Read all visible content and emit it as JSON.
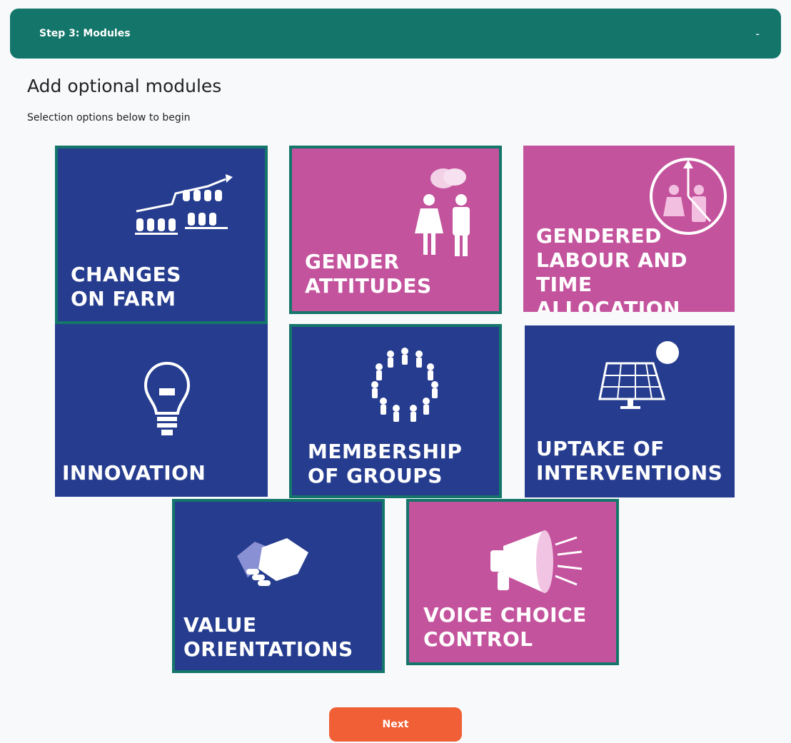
{
  "header": {
    "title": "Step 3: Modules",
    "toggle": "-"
  },
  "page": {
    "title": "Add optional modules",
    "subtitle": "Selection options below to begin"
  },
  "modules": [
    {
      "label": "CHANGES\nON FARM",
      "icon": "farm-growth-icon",
      "color": "#263d8f",
      "selected": true
    },
    {
      "label": "GENDER\nATTITUDES",
      "icon": "gender-people-icon",
      "color": "#c4539d",
      "selected": true
    },
    {
      "label": "GENDERED\nLABOUR AND\nTIME ALLOCATION",
      "icon": "clock-people-icon",
      "color": "#c4539d",
      "selected": false
    },
    {
      "label": "INNOVATION",
      "icon": "light-bulb-icon",
      "color": "#263d8f",
      "selected": false
    },
    {
      "label": "MEMBERSHIP\nOF GROUPS",
      "icon": "group-circle-icon",
      "color": "#263d8f",
      "selected": true
    },
    {
      "label": "UPTAKE OF\nINTERVENTIONS",
      "icon": "solar-panel-icon",
      "color": "#263d8f",
      "selected": false
    },
    {
      "label": "VALUE\nORIENTATIONS",
      "icon": "handshake-icon",
      "color": "#263d8f",
      "selected": true
    },
    {
      "label": "VOICE CHOICE\nCONTROL",
      "icon": "megaphone-icon",
      "color": "#c4539d",
      "selected": true
    }
  ],
  "footer": {
    "next_label": "Next"
  },
  "colors": {
    "teal": "#14766a",
    "blue": "#263d8f",
    "pink": "#c4539d",
    "orange": "#f05f35"
  }
}
